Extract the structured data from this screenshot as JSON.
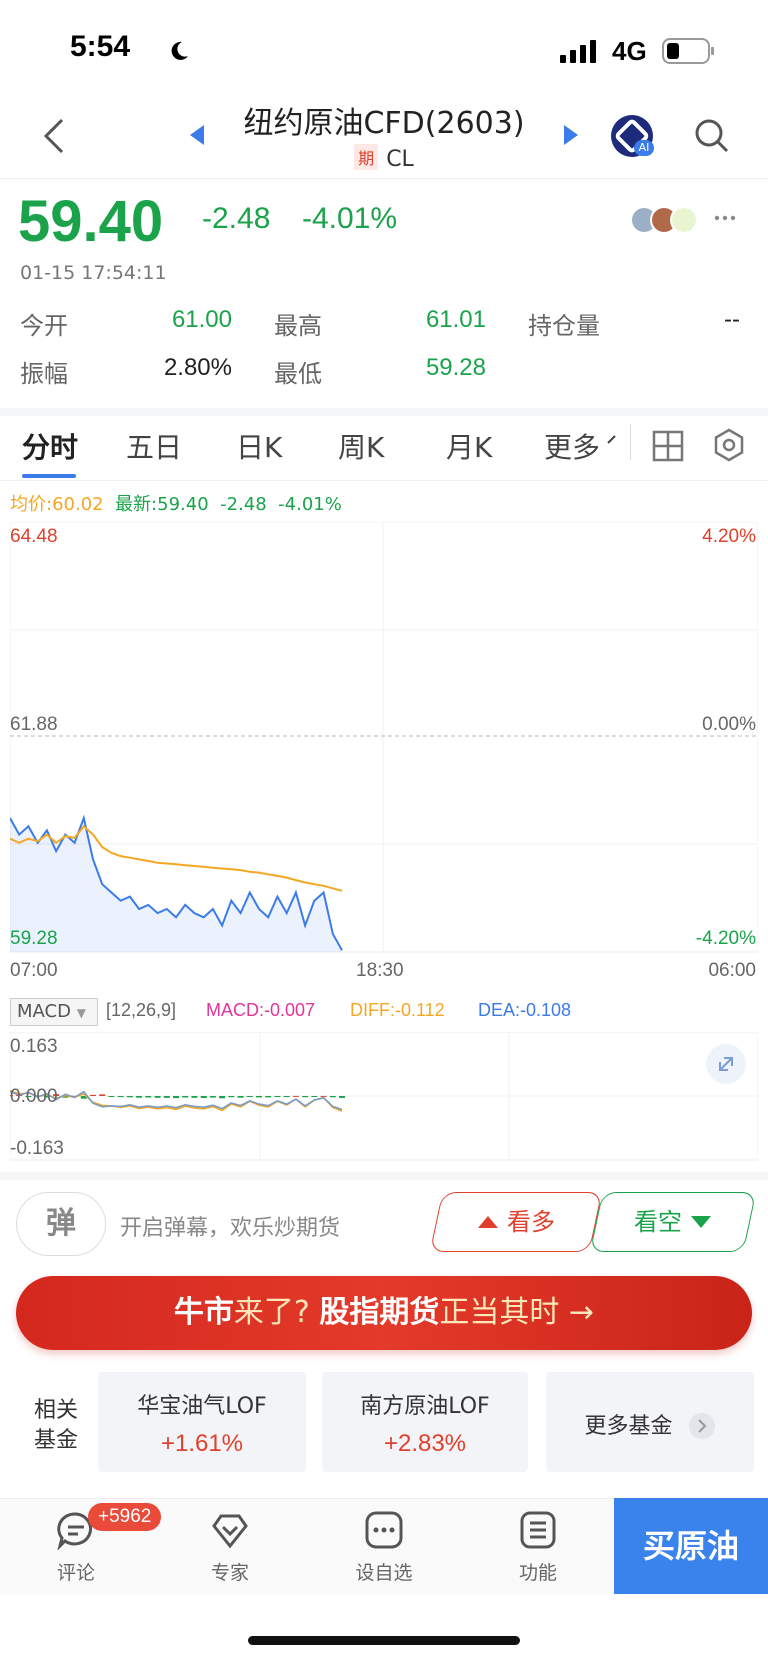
{
  "status_bar": {
    "time": "5:54",
    "network": "4G"
  },
  "header": {
    "title": "纽约原油CFD(2603)",
    "tag": "期",
    "code": "CL",
    "ai_badge": "AI"
  },
  "quote": {
    "price": "59.40",
    "change": "-2.48",
    "change_pct": "-4.01%",
    "timestamp": "01-15 17:54:11",
    "stats": [
      {
        "label": "今开",
        "value": "61.00",
        "color": "#1aa34a"
      },
      {
        "label": "最高",
        "value": "61.01",
        "color": "#1aa34a"
      },
      {
        "label": "持仓量",
        "value": "--",
        "color": "#222222"
      },
      {
        "label": "振幅",
        "value": "2.80%",
        "color": "#222222"
      },
      {
        "label": "最低",
        "value": "59.28",
        "color": "#1aa34a"
      }
    ]
  },
  "tabs": [
    "分时",
    "五日",
    "日K",
    "周K",
    "月K",
    "更多"
  ],
  "chart": {
    "legend": {
      "avg_label": "均价:60.02",
      "latest_label": "最新:59.40",
      "change": "-2.48",
      "change_pct": "-4.01%"
    },
    "y_left": [
      "64.48",
      "61.88",
      "59.28"
    ],
    "y_right": [
      "4.20%",
      "0.00%",
      "-4.20%"
    ],
    "x_labels": [
      "07:00",
      "18:30",
      "06:00"
    ],
    "macd": {
      "selector": "MACD",
      "params": "[12,26,9]",
      "macd": "MACD:-0.007",
      "diff": "DIFF:-0.112",
      "dea": "DEA:-0.108",
      "y_top": "0.163",
      "y_mid": "0.000",
      "y_bottom": "-0.163"
    }
  },
  "chart_data": {
    "type": "line",
    "ylim": [
      59.28,
      64.48
    ],
    "baseline": 61.88,
    "series": [
      {
        "name": "最新",
        "values": [
          60.9,
          60.7,
          60.8,
          60.6,
          60.75,
          60.5,
          60.7,
          60.6,
          60.9,
          60.4,
          60.1,
          60.0,
          59.9,
          59.95,
          59.8,
          59.85,
          59.75,
          59.8,
          59.7,
          59.85,
          59.75,
          59.7,
          59.8,
          59.6,
          59.9,
          59.75,
          60.0,
          59.8,
          59.7,
          59.95,
          59.75,
          60.0,
          59.6,
          59.9,
          60.0,
          59.5,
          59.3
        ]
      },
      {
        "name": "均价",
        "values": [
          60.65,
          60.6,
          60.65,
          60.62,
          60.7,
          60.6,
          60.68,
          60.66,
          60.8,
          60.7,
          60.55,
          60.48,
          60.44,
          60.42,
          60.4,
          60.38,
          60.36,
          60.35,
          60.34,
          60.33,
          60.32,
          60.31,
          60.3,
          60.29,
          60.28,
          60.27,
          60.25,
          60.24,
          60.22,
          60.2,
          60.18,
          60.15,
          60.12,
          60.1,
          60.08,
          60.05,
          60.02
        ]
      }
    ]
  },
  "actions": {
    "danmu_icon": "弹",
    "danmu_placeholder": "开启弹幕，欢乐炒期货",
    "bull": "看多",
    "bear": "看空"
  },
  "banner": {
    "part1": "牛市",
    "part2": "来了? ",
    "part3": "股指期货",
    "part4": "正当其时 →"
  },
  "funds": {
    "label_line1": "相关",
    "label_line2": "基金",
    "items": [
      {
        "name": "华宝油气LOF",
        "value": "+1.61%"
      },
      {
        "name": "南方原油LOF",
        "value": "+2.83%"
      }
    ],
    "more": "更多基金"
  },
  "bottom_nav": {
    "badge": "+5962",
    "items": [
      "评论",
      "专家",
      "设自选",
      "功能"
    ],
    "buy": "买原油"
  }
}
